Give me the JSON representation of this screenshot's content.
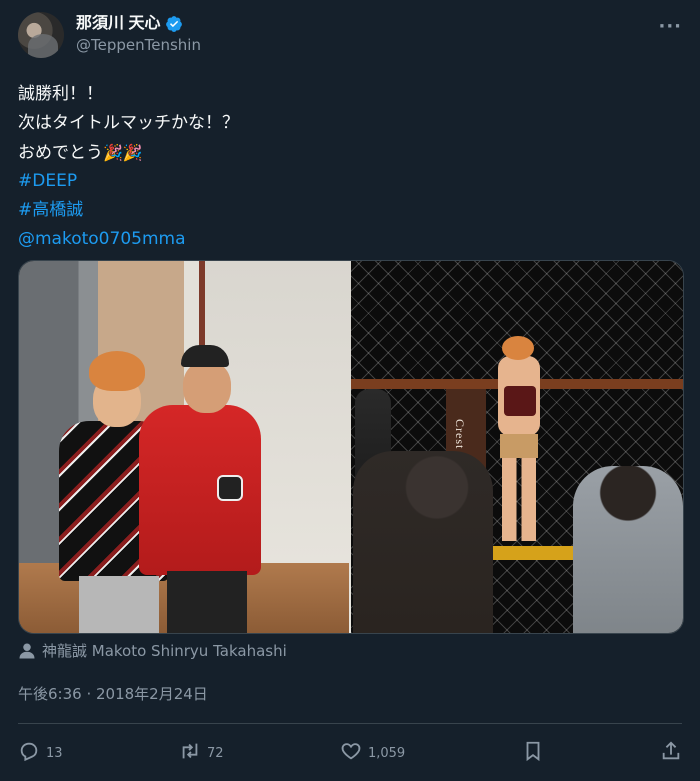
{
  "user": {
    "display_name": "那須川 天心",
    "handle": "@TeppenTenshin",
    "verified": true,
    "avatar_icon": "avatar-photo"
  },
  "more_icon": "more-horizontal-icon",
  "tweet": {
    "lines": [
      "誠勝利！！",
      "次はタイトルマッチかな！？",
      "おめでとう"
    ],
    "emoji": "🎉🎉",
    "hashtags": [
      "#DEEP",
      "#高橋誠"
    ],
    "mention": "@makoto0705mma"
  },
  "media": {
    "photo_count": 2,
    "crest_text": "Crest"
  },
  "credit": "神龍誠 Makoto Shinryu Takahashi",
  "timestamp": "午後6:36 · 2018年2月24日",
  "actions": {
    "replies": "13",
    "retweets": "72",
    "likes": "1,059"
  },
  "colors": {
    "background": "#15202b",
    "text": "#f7f9f9",
    "secondary": "#8b98a5",
    "link": "#1d9bf0",
    "verified": "#1d9bf0",
    "border": "#38444d"
  }
}
